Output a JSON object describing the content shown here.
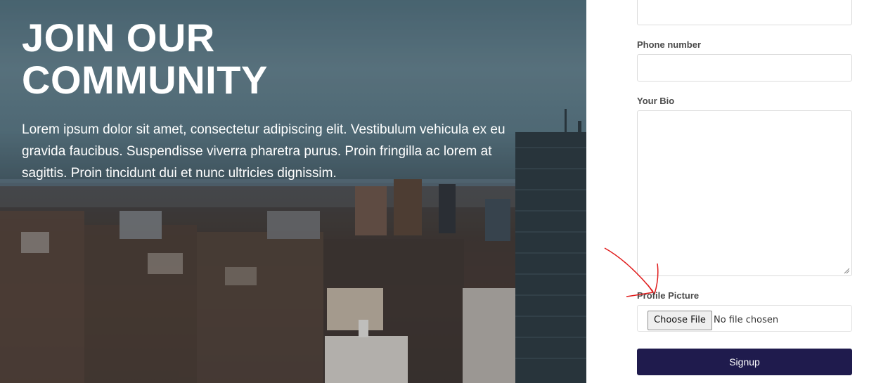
{
  "hero": {
    "title_line1": "JOIN OUR",
    "title_line2": "COMMUNITY",
    "description": "Lorem ipsum dolor sit amet, consectetur adipiscing elit. Vestibulum vehicula ex eu gravida faucibus. Suspendisse viverra pharetra purus. Proin fringilla ac lorem at sagittis. Proin tincidunt dui et nunc ultricies dignissim."
  },
  "form": {
    "top_field_value": "",
    "phone_label": "Phone number",
    "phone_value": "",
    "bio_label": "Your Bio",
    "bio_value": "",
    "picture_label": "Profile Picture",
    "file_button_label": "Choose File",
    "file_status": "No file chosen",
    "submit_label": "Signup"
  },
  "colors": {
    "submit_background": "#1f1b4d",
    "annotation_red": "#e01b1b"
  }
}
